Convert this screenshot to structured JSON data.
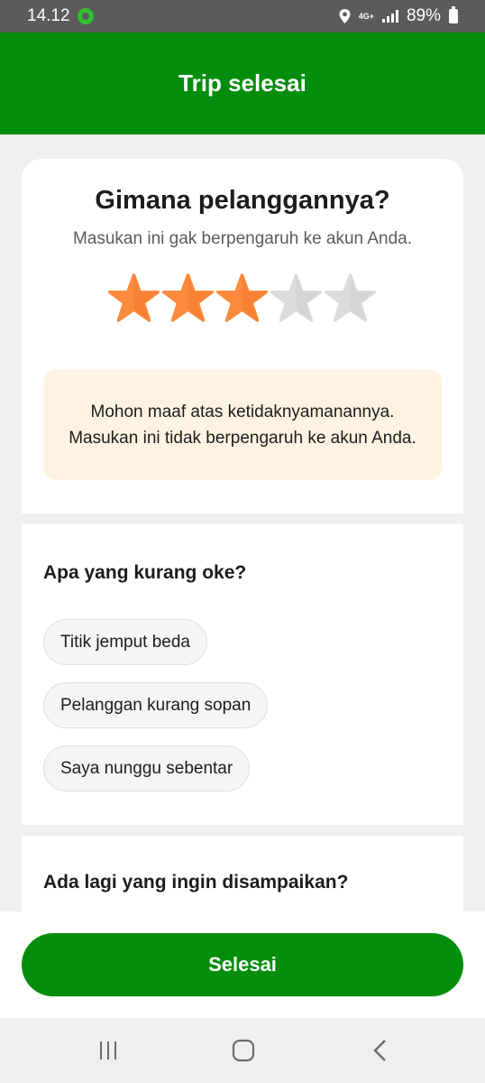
{
  "status_bar": {
    "time": "14.12",
    "network": "4G+",
    "battery": "89%"
  },
  "app_bar": {
    "title": "Trip selesai"
  },
  "rating": {
    "question": "Gimana pelanggannya?",
    "subtitle": "Masukan ini gak berpengaruh ke akun Anda.",
    "value": 3,
    "max": 5,
    "filled_color": "#fb8a3c",
    "empty_color": "#dcdcdc"
  },
  "notice": {
    "text": "Mohon maaf atas ketidaknyamanannya. Masukan ini tidak berpengaruh ke akun Anda."
  },
  "issues": {
    "title": "Apa yang kurang oke?",
    "options": [
      "Titik jemput beda",
      "Pelanggan kurang sopan",
      "Saya nunggu sebentar"
    ]
  },
  "extra": {
    "title": "Ada lagi yang ingin disampaikan?"
  },
  "footer": {
    "done_label": "Selesai"
  },
  "colors": {
    "brand_green": "#038d0c",
    "notice_bg": "#fef3e2"
  }
}
